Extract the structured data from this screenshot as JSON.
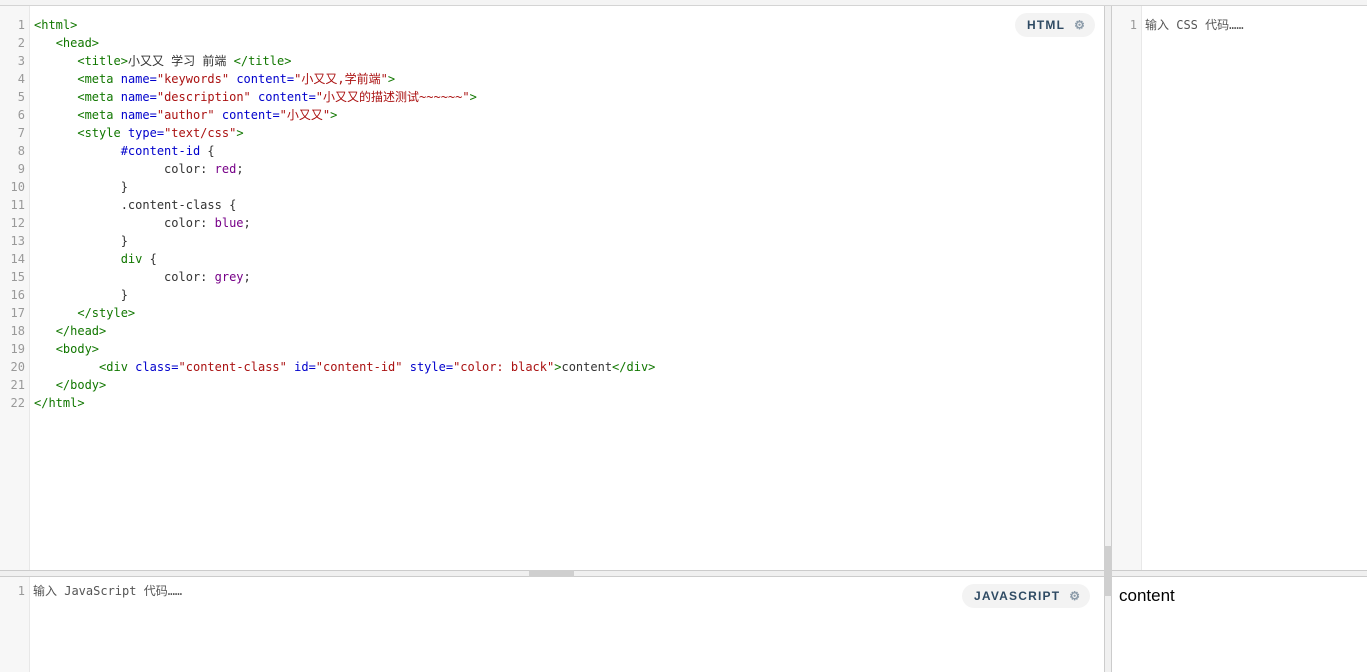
{
  "html_editor": {
    "language_label": "HTML",
    "settings_icon": "gear-icon",
    "lines": [
      [
        [
          "tag",
          "<html>"
        ]
      ],
      [
        [
          "plain",
          "   "
        ],
        [
          "tag",
          "<head>"
        ]
      ],
      [
        [
          "plain",
          "      "
        ],
        [
          "tag",
          "<title>"
        ],
        [
          "plain",
          "小又又 学习 前端 "
        ],
        [
          "tag",
          "</title>"
        ]
      ],
      [
        [
          "plain",
          "      "
        ],
        [
          "tag",
          "<meta "
        ],
        [
          "attr",
          "name="
        ],
        [
          "str",
          "\"keywords\""
        ],
        [
          "attr",
          " content="
        ],
        [
          "str",
          "\"小又又,学前端\""
        ],
        [
          "tag",
          ">"
        ]
      ],
      [
        [
          "plain",
          "      "
        ],
        [
          "tag",
          "<meta "
        ],
        [
          "attr",
          "name="
        ],
        [
          "str",
          "\"description\""
        ],
        [
          "attr",
          " content="
        ],
        [
          "str",
          "\"小又又的描述测试~~~~~~\""
        ],
        [
          "tag",
          ">"
        ]
      ],
      [
        [
          "plain",
          "      "
        ],
        [
          "tag",
          "<meta "
        ],
        [
          "attr",
          "name="
        ],
        [
          "str",
          "\"author\""
        ],
        [
          "attr",
          " content="
        ],
        [
          "str",
          "\"小又又\""
        ],
        [
          "tag",
          ">"
        ]
      ],
      [
        [
          "plain",
          "      "
        ],
        [
          "tag",
          "<style "
        ],
        [
          "attr",
          "type="
        ],
        [
          "str",
          "\"text/css\""
        ],
        [
          "tag",
          ">"
        ]
      ],
      [
        [
          "plain",
          "            "
        ],
        [
          "attr",
          "#content-id"
        ],
        [
          "plain",
          " {"
        ]
      ],
      [
        [
          "plain",
          "                  color: "
        ],
        [
          "val",
          "red"
        ],
        [
          "plain",
          ";"
        ]
      ],
      [
        [
          "plain",
          "            }"
        ]
      ],
      [
        [
          "plain",
          "            .content-class {"
        ]
      ],
      [
        [
          "plain",
          "                  color: "
        ],
        [
          "val",
          "blue"
        ],
        [
          "plain",
          ";"
        ]
      ],
      [
        [
          "plain",
          "            }"
        ]
      ],
      [
        [
          "plain",
          "            "
        ],
        [
          "tag",
          "div"
        ],
        [
          "plain",
          " {"
        ]
      ],
      [
        [
          "plain",
          "                  color: "
        ],
        [
          "val",
          "grey"
        ],
        [
          "plain",
          ";"
        ]
      ],
      [
        [
          "plain",
          "            }"
        ]
      ],
      [
        [
          "plain",
          "      "
        ],
        [
          "tag",
          "</style>"
        ]
      ],
      [
        [
          "plain",
          "   "
        ],
        [
          "tag",
          "</head>"
        ]
      ],
      [
        [
          "plain",
          "   "
        ],
        [
          "tag",
          "<body>"
        ]
      ],
      [
        [
          "plain",
          "         "
        ],
        [
          "tag",
          "<div "
        ],
        [
          "attr",
          "class="
        ],
        [
          "str",
          "\"content-class\""
        ],
        [
          "attr",
          " id="
        ],
        [
          "str",
          "\"content-id\""
        ],
        [
          "attr",
          " style="
        ],
        [
          "str",
          "\"color: black\""
        ],
        [
          "tag",
          ">"
        ],
        [
          "plain",
          "content"
        ],
        [
          "tag",
          "</div>"
        ]
      ],
      [
        [
          "plain",
          "   "
        ],
        [
          "tag",
          "</body>"
        ]
      ],
      [
        [
          "tag",
          "</html>"
        ]
      ]
    ]
  },
  "css_editor": {
    "line_number": "1",
    "placeholder": "输入 CSS 代码……"
  },
  "js_editor": {
    "language_label": "JAVASCRIPT",
    "settings_icon": "gear-icon",
    "line_number": "1",
    "placeholder": "输入 JavaScript 代码……"
  },
  "result": {
    "text": "content"
  },
  "colors": {
    "tag": "#117700",
    "attribute": "#0000cc",
    "string": "#aa1111",
    "value": "#770088"
  }
}
